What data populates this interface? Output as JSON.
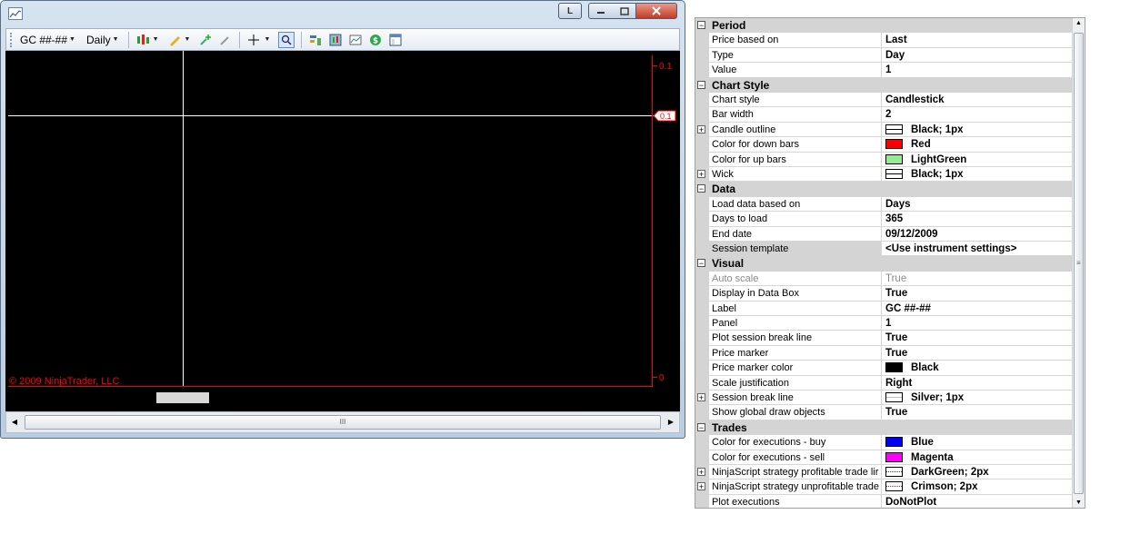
{
  "window": {
    "link_label": "L",
    "toolbar": {
      "instrument": "GC ##-##",
      "interval": "Daily"
    },
    "chart": {
      "price_top": "0.1",
      "price_marker": "0.1",
      "price_bottom": "0",
      "copyright": "© 2009 NinjaTrader, LLC",
      "colors": {
        "background": "#000000",
        "axis": "#ff0000",
        "crosshair": "#ffffff"
      }
    },
    "scrollbar": {
      "grip": "III"
    }
  },
  "property_grid": {
    "categories": [
      {
        "name": "Period",
        "props": [
          {
            "name": "Price based on",
            "value": "Last"
          },
          {
            "name": "Type",
            "value": "Day"
          },
          {
            "name": "Value",
            "value": "1"
          }
        ]
      },
      {
        "name": "Chart Style",
        "props": [
          {
            "name": "Chart style",
            "value": "Candlestick"
          },
          {
            "name": "Bar width",
            "value": "2"
          },
          {
            "name": "Candle outline",
            "value": "Black; 1px",
            "expandable": true,
            "swatch": "line"
          },
          {
            "name": "Color for down bars",
            "value": "Red",
            "swatch_color": "#ff0000"
          },
          {
            "name": "Color for up bars",
            "value": "LightGreen",
            "swatch_color": "#90ee90"
          },
          {
            "name": "Wick",
            "value": "Black; 1px",
            "expandable": true,
            "swatch": "line"
          }
        ]
      },
      {
        "name": "Data",
        "props": [
          {
            "name": "Load data based on",
            "value": "Days"
          },
          {
            "name": "Days to load",
            "value": "365"
          },
          {
            "name": "End date",
            "value": "09/12/2009"
          },
          {
            "name": "Session template",
            "value": "<Use instrument settings>",
            "selected": true
          }
        ]
      },
      {
        "name": "Visual",
        "props": [
          {
            "name": "Auto scale",
            "value": "True",
            "disabled": true
          },
          {
            "name": "Display in Data Box",
            "value": "True"
          },
          {
            "name": "Label",
            "value": "GC ##-##"
          },
          {
            "name": "Panel",
            "value": "1"
          },
          {
            "name": "Plot session break line",
            "value": "True"
          },
          {
            "name": "Price marker",
            "value": "True"
          },
          {
            "name": "Price marker color",
            "value": "Black",
            "swatch_color": "#000000"
          },
          {
            "name": "Scale justification",
            "value": "Right"
          },
          {
            "name": "Session break line",
            "value": "Silver; 1px",
            "expandable": true,
            "swatch": "silver"
          },
          {
            "name": "Show global draw objects",
            "value": "True"
          }
        ]
      },
      {
        "name": "Trades",
        "props": [
          {
            "name": "Color for executions - buy",
            "value": "Blue",
            "swatch_color": "#0000ff"
          },
          {
            "name": "Color for executions - sell",
            "value": "Magenta",
            "swatch_color": "#ff00ff"
          },
          {
            "name": "NinjaScript strategy profitable trade lir",
            "value": "DarkGreen; 2px",
            "expandable": true,
            "swatch": "dot-green"
          },
          {
            "name": "NinjaScript strategy unprofitable trade",
            "value": "Crimson; 2px",
            "expandable": true,
            "swatch": "dot-crim"
          },
          {
            "name": "Plot executions",
            "value": "DoNotPlot"
          }
        ]
      }
    ]
  }
}
